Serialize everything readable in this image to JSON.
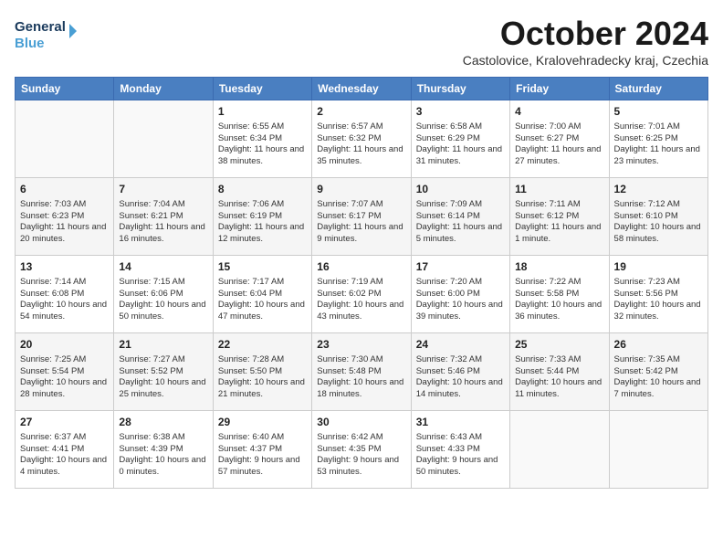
{
  "header": {
    "logo_line1": "General",
    "logo_line2": "Blue",
    "month_title": "October 2024",
    "location": "Castolovice, Kralovehradecky kraj, Czechia"
  },
  "weekdays": [
    "Sunday",
    "Monday",
    "Tuesday",
    "Wednesday",
    "Thursday",
    "Friday",
    "Saturday"
  ],
  "weeks": [
    [
      {
        "day": "",
        "info": ""
      },
      {
        "day": "",
        "info": ""
      },
      {
        "day": "1",
        "info": "Sunrise: 6:55 AM\nSunset: 6:34 PM\nDaylight: 11 hours\nand 38 minutes."
      },
      {
        "day": "2",
        "info": "Sunrise: 6:57 AM\nSunset: 6:32 PM\nDaylight: 11 hours\nand 35 minutes."
      },
      {
        "day": "3",
        "info": "Sunrise: 6:58 AM\nSunset: 6:29 PM\nDaylight: 11 hours\nand 31 minutes."
      },
      {
        "day": "4",
        "info": "Sunrise: 7:00 AM\nSunset: 6:27 PM\nDaylight: 11 hours\nand 27 minutes."
      },
      {
        "day": "5",
        "info": "Sunrise: 7:01 AM\nSunset: 6:25 PM\nDaylight: 11 hours\nand 23 minutes."
      }
    ],
    [
      {
        "day": "6",
        "info": "Sunrise: 7:03 AM\nSunset: 6:23 PM\nDaylight: 11 hours\nand 20 minutes."
      },
      {
        "day": "7",
        "info": "Sunrise: 7:04 AM\nSunset: 6:21 PM\nDaylight: 11 hours\nand 16 minutes."
      },
      {
        "day": "8",
        "info": "Sunrise: 7:06 AM\nSunset: 6:19 PM\nDaylight: 11 hours\nand 12 minutes."
      },
      {
        "day": "9",
        "info": "Sunrise: 7:07 AM\nSunset: 6:17 PM\nDaylight: 11 hours\nand 9 minutes."
      },
      {
        "day": "10",
        "info": "Sunrise: 7:09 AM\nSunset: 6:14 PM\nDaylight: 11 hours\nand 5 minutes."
      },
      {
        "day": "11",
        "info": "Sunrise: 7:11 AM\nSunset: 6:12 PM\nDaylight: 11 hours\nand 1 minute."
      },
      {
        "day": "12",
        "info": "Sunrise: 7:12 AM\nSunset: 6:10 PM\nDaylight: 10 hours\nand 58 minutes."
      }
    ],
    [
      {
        "day": "13",
        "info": "Sunrise: 7:14 AM\nSunset: 6:08 PM\nDaylight: 10 hours\nand 54 minutes."
      },
      {
        "day": "14",
        "info": "Sunrise: 7:15 AM\nSunset: 6:06 PM\nDaylight: 10 hours\nand 50 minutes."
      },
      {
        "day": "15",
        "info": "Sunrise: 7:17 AM\nSunset: 6:04 PM\nDaylight: 10 hours\nand 47 minutes."
      },
      {
        "day": "16",
        "info": "Sunrise: 7:19 AM\nSunset: 6:02 PM\nDaylight: 10 hours\nand 43 minutes."
      },
      {
        "day": "17",
        "info": "Sunrise: 7:20 AM\nSunset: 6:00 PM\nDaylight: 10 hours\nand 39 minutes."
      },
      {
        "day": "18",
        "info": "Sunrise: 7:22 AM\nSunset: 5:58 PM\nDaylight: 10 hours\nand 36 minutes."
      },
      {
        "day": "19",
        "info": "Sunrise: 7:23 AM\nSunset: 5:56 PM\nDaylight: 10 hours\nand 32 minutes."
      }
    ],
    [
      {
        "day": "20",
        "info": "Sunrise: 7:25 AM\nSunset: 5:54 PM\nDaylight: 10 hours\nand 28 minutes."
      },
      {
        "day": "21",
        "info": "Sunrise: 7:27 AM\nSunset: 5:52 PM\nDaylight: 10 hours\nand 25 minutes."
      },
      {
        "day": "22",
        "info": "Sunrise: 7:28 AM\nSunset: 5:50 PM\nDaylight: 10 hours\nand 21 minutes."
      },
      {
        "day": "23",
        "info": "Sunrise: 7:30 AM\nSunset: 5:48 PM\nDaylight: 10 hours\nand 18 minutes."
      },
      {
        "day": "24",
        "info": "Sunrise: 7:32 AM\nSunset: 5:46 PM\nDaylight: 10 hours\nand 14 minutes."
      },
      {
        "day": "25",
        "info": "Sunrise: 7:33 AM\nSunset: 5:44 PM\nDaylight: 10 hours\nand 11 minutes."
      },
      {
        "day": "26",
        "info": "Sunrise: 7:35 AM\nSunset: 5:42 PM\nDaylight: 10 hours\nand 7 minutes."
      }
    ],
    [
      {
        "day": "27",
        "info": "Sunrise: 6:37 AM\nSunset: 4:41 PM\nDaylight: 10 hours\nand 4 minutes."
      },
      {
        "day": "28",
        "info": "Sunrise: 6:38 AM\nSunset: 4:39 PM\nDaylight: 10 hours\nand 0 minutes."
      },
      {
        "day": "29",
        "info": "Sunrise: 6:40 AM\nSunset: 4:37 PM\nDaylight: 9 hours\nand 57 minutes."
      },
      {
        "day": "30",
        "info": "Sunrise: 6:42 AM\nSunset: 4:35 PM\nDaylight: 9 hours\nand 53 minutes."
      },
      {
        "day": "31",
        "info": "Sunrise: 6:43 AM\nSunset: 4:33 PM\nDaylight: 9 hours\nand 50 minutes."
      },
      {
        "day": "",
        "info": ""
      },
      {
        "day": "",
        "info": ""
      }
    ]
  ]
}
